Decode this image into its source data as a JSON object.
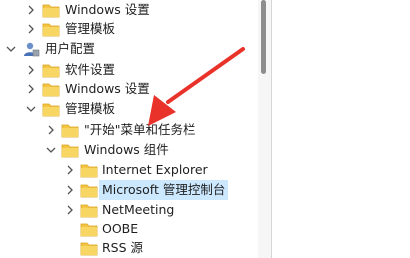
{
  "tree": {
    "items": [
      {
        "label": "Windows 设置",
        "expanded": false,
        "icon": "folder-icon"
      },
      {
        "label": "管理模板",
        "expanded": false,
        "icon": "folder-icon"
      },
      {
        "label": "用户配置",
        "expanded": true,
        "icon": "user-config-icon"
      },
      {
        "label": "软件设置",
        "expanded": false,
        "icon": "folder-icon"
      },
      {
        "label": "Windows 设置",
        "expanded": false,
        "icon": "folder-icon"
      },
      {
        "label": "管理模板",
        "expanded": true,
        "icon": "folder-icon"
      },
      {
        "label": "\"开始\"菜单和任务栏",
        "expanded": false,
        "icon": "folder-icon"
      },
      {
        "label": "Windows 组件",
        "expanded": true,
        "icon": "folder-icon"
      },
      {
        "label": "Internet Explorer",
        "expanded": false,
        "icon": "folder-icon"
      },
      {
        "label": "Microsoft 管理控制台",
        "expanded": false,
        "selected": true,
        "icon": "folder-icon"
      },
      {
        "label": "NetMeeting",
        "expanded": false,
        "icon": "folder-icon"
      },
      {
        "label": "OOBE",
        "expanded": false,
        "icon": "folder-icon"
      },
      {
        "label": "RSS 源",
        "expanded": false,
        "icon": "folder-icon"
      }
    ]
  },
  "colors": {
    "selection": "#cce8ff",
    "folder": "#f3c543",
    "annotation_arrow": "#e8322a"
  }
}
